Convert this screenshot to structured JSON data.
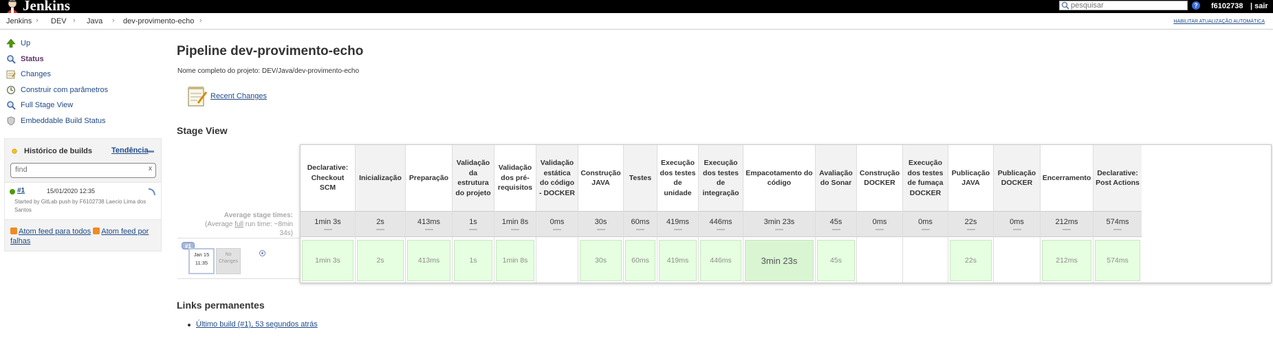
{
  "header": {
    "brand": "Jenkins",
    "search_placeholder": "pesquisar",
    "help": "?",
    "user": "f6102738",
    "logout": "| sair"
  },
  "breadcrumbs": {
    "items": [
      "Jenkins",
      "DEV",
      "Java",
      "dev-provimento-echo"
    ],
    "separator": "›",
    "auto_refresh": "HABILITAR ATUALIZAÇÃO AUTOMÁTICA"
  },
  "sidebar": {
    "tasks": [
      {
        "label": "Up",
        "icon": "up-arrow-icon"
      },
      {
        "label": "Status",
        "icon": "search-icon"
      },
      {
        "label": "Changes",
        "icon": "notepad-icon"
      },
      {
        "label": "Construir com parâmetros",
        "icon": "clock-icon"
      },
      {
        "label": "Full Stage View",
        "icon": "search-icon"
      },
      {
        "label": "Embeddable Build Status",
        "icon": "shield-icon"
      }
    ]
  },
  "build_history": {
    "title": "Histórico de builds",
    "trend": "Tendência",
    "filter_placeholder": "find",
    "clear": "x",
    "builds": [
      {
        "number": "#1",
        "date": "15/01/2020 12:35",
        "cause": "Started by GitLab push by F6102738 Laecio Lima dos Santos"
      }
    ],
    "feed_all": "Atom feed para todos",
    "feed_failures": "Atom feed por falhas"
  },
  "main": {
    "title": "Pipeline dev-provimento-echo",
    "full_name": "Nome completo do projeto: DEV/Java/dev-provimento-echo",
    "recent_changes": "Recent Changes",
    "stage_view_title": "Stage View",
    "permalinks_title": "Links permanentes",
    "permalinks": [
      "Último build (#1), 53 segundos atrás"
    ]
  },
  "stage_view": {
    "summary_line1": "Average stage times:",
    "summary_line2_prefix": "(Average ",
    "summary_line2_full": "full",
    "summary_line2_suffix": " run time: ~8min",
    "summary_line3": "34s)",
    "run": {
      "badge": "#1",
      "month_day": "Jan 15",
      "time": "11:35",
      "changes_line1": "No",
      "changes_line2": "Changes"
    },
    "stages": [
      {
        "name": "Declarative: Checkout SCM",
        "avg": "1min 3s",
        "run": "1min 3s",
        "status": "success"
      },
      {
        "name": "Inicialização",
        "avg": "2s",
        "run": "2s",
        "status": "success"
      },
      {
        "name": "Preparação",
        "avg": "413ms",
        "run": "413ms",
        "status": "success"
      },
      {
        "name": "Validação da estrutura do projeto",
        "avg": "1s",
        "run": "1s",
        "status": "success"
      },
      {
        "name": "Validação dos pré-requisitos",
        "avg": "1min 8s",
        "run": "1min 8s",
        "status": "success"
      },
      {
        "name": "Validação estática do código - DOCKER",
        "avg": "0ms",
        "run": "",
        "status": "skipped"
      },
      {
        "name": "Construção JAVA",
        "avg": "30s",
        "run": "30s",
        "status": "success"
      },
      {
        "name": "Testes",
        "avg": "60ms",
        "run": "60ms",
        "status": "success"
      },
      {
        "name": "Execução dos testes de unidade",
        "avg": "419ms",
        "run": "419ms",
        "status": "success"
      },
      {
        "name": "Execução dos testes de integração",
        "avg": "446ms",
        "run": "446ms",
        "status": "success"
      },
      {
        "name": "Empacotamento do código",
        "avg": "3min 23s",
        "run": "3min 23s",
        "status": "success-long"
      },
      {
        "name": "Avaliação do Sonar",
        "avg": "45s",
        "run": "45s",
        "status": "success"
      },
      {
        "name": "Construção DOCKER",
        "avg": "0ms",
        "run": "",
        "status": "skipped"
      },
      {
        "name": "Execução dos testes de fumaça DOCKER",
        "avg": "0ms",
        "run": "",
        "status": "skipped"
      },
      {
        "name": "Publicação JAVA",
        "avg": "22s",
        "run": "22s",
        "status": "success"
      },
      {
        "name": "Publicação DOCKER",
        "avg": "0ms",
        "run": "",
        "status": "skipped"
      },
      {
        "name": "Encerramento",
        "avg": "212ms",
        "run": "212ms",
        "status": "success"
      },
      {
        "name": "Declarative: Post Actions",
        "avg": "574ms",
        "run": "574ms",
        "status": "success"
      }
    ]
  }
}
